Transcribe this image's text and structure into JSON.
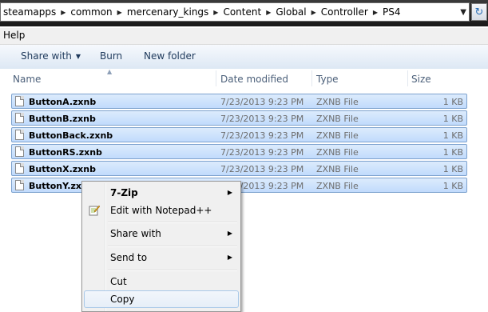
{
  "address": {
    "breadcrumbs": [
      "steamapps",
      "common",
      "mercenary_kings",
      "Content",
      "Global",
      "Controller",
      "PS4"
    ]
  },
  "menubar": {
    "help_label": "Help"
  },
  "toolbar": {
    "share_with_label": "Share with",
    "burn_label": "Burn",
    "new_folder_label": "New folder"
  },
  "columns": {
    "name": "Name",
    "date_modified": "Date modified",
    "type": "Type",
    "size": "Size"
  },
  "files": [
    {
      "name": "ButtonA.zxnb",
      "date": "7/23/2013 9:23 PM",
      "type": "ZXNB File",
      "size": "1 KB"
    },
    {
      "name": "ButtonB.zxnb",
      "date": "7/23/2013 9:23 PM",
      "type": "ZXNB File",
      "size": "1 KB"
    },
    {
      "name": "ButtonBack.zxnb",
      "date": "7/23/2013 9:23 PM",
      "type": "ZXNB File",
      "size": "1 KB"
    },
    {
      "name": "ButtonRS.zxnb",
      "date": "7/23/2013 9:23 PM",
      "type": "ZXNB File",
      "size": "1 KB"
    },
    {
      "name": "ButtonX.zxnb",
      "date": "7/23/2013 9:23 PM",
      "type": "ZXNB File",
      "size": "1 KB"
    },
    {
      "name": "ButtonY.zxnb",
      "date": "7/23/2013 9:23 PM",
      "type": "ZXNB File",
      "size": "1 KB"
    }
  ],
  "context_menu": {
    "items": [
      {
        "label": "7-Zip",
        "submenu": true
      },
      {
        "label": "Edit with Notepad++",
        "icon": "notepad-plus-plus-icon"
      },
      {
        "label": "Share with",
        "submenu": true
      },
      {
        "label": "Send to",
        "submenu": true
      },
      {
        "label": "Cut"
      },
      {
        "label": "Copy",
        "highlighted": true
      }
    ]
  },
  "icons": {
    "breadcrumb_separator": "breadcrumb-chevron-icon",
    "address_dropdown": "chevron-down-icon",
    "refresh": "refresh-icon",
    "file": "file-icon",
    "submenu_arrow": "submenu-arrow-icon"
  },
  "colors": {
    "selection_fill": "#cce1fb",
    "selection_border": "#7da2ce",
    "menu_background": "#f0f0f0",
    "toolbar_text": "#1e395b"
  }
}
